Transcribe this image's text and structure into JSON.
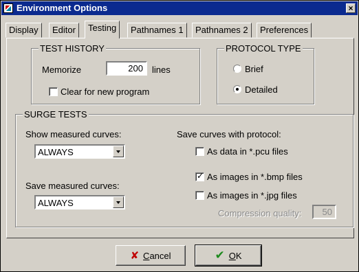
{
  "window": {
    "title": "Environment Options",
    "close_glyph": "×"
  },
  "tabs": [
    {
      "label": "Display",
      "active": false
    },
    {
      "label": "Editor",
      "active": false
    },
    {
      "label": "Testing",
      "active": true
    },
    {
      "label": "Pathnames 1",
      "active": false
    },
    {
      "label": "Pathnames 2",
      "active": false
    },
    {
      "label": "Preferences",
      "active": false
    }
  ],
  "test_history": {
    "title": "TEST HISTORY",
    "memorize_label": "Memorize",
    "memorize_value": "200",
    "lines_label": "lines",
    "clear_label": "Clear for new program",
    "clear_checked": false
  },
  "protocol_type": {
    "title": "PROTOCOL TYPE",
    "options": [
      {
        "label": "Brief",
        "selected": false
      },
      {
        "label": "Detailed",
        "selected": true
      }
    ]
  },
  "surge_tests": {
    "title": "SURGE TESTS",
    "show_label": "Show measured curves:",
    "show_value": "ALWAYS",
    "save_label": "Save measured curves:",
    "save_value": "ALWAYS",
    "protocol_label": "Save curves with protocol:",
    "pcu_label": "As data in *.pcu files",
    "pcu_checked": false,
    "bmp_label": "As images in *.bmp files",
    "bmp_checked": true,
    "jpg_label": "As images in *.jpg files",
    "jpg_checked": false,
    "quality_label": "Compression quality:",
    "quality_value": "50"
  },
  "buttons": {
    "cancel_prefix": "",
    "cancel_accel": "C",
    "cancel_rest": "ancel",
    "ok_accel": "O",
    "ok_rest": "K",
    "cancel_icon": "x-icon",
    "ok_icon": "checkmark-icon"
  },
  "colors": {
    "titlebar": "#0b2a8f",
    "face": "#d4d0c8",
    "cancel_icon": "#c00000",
    "ok_icon": "#1d8a1d"
  }
}
